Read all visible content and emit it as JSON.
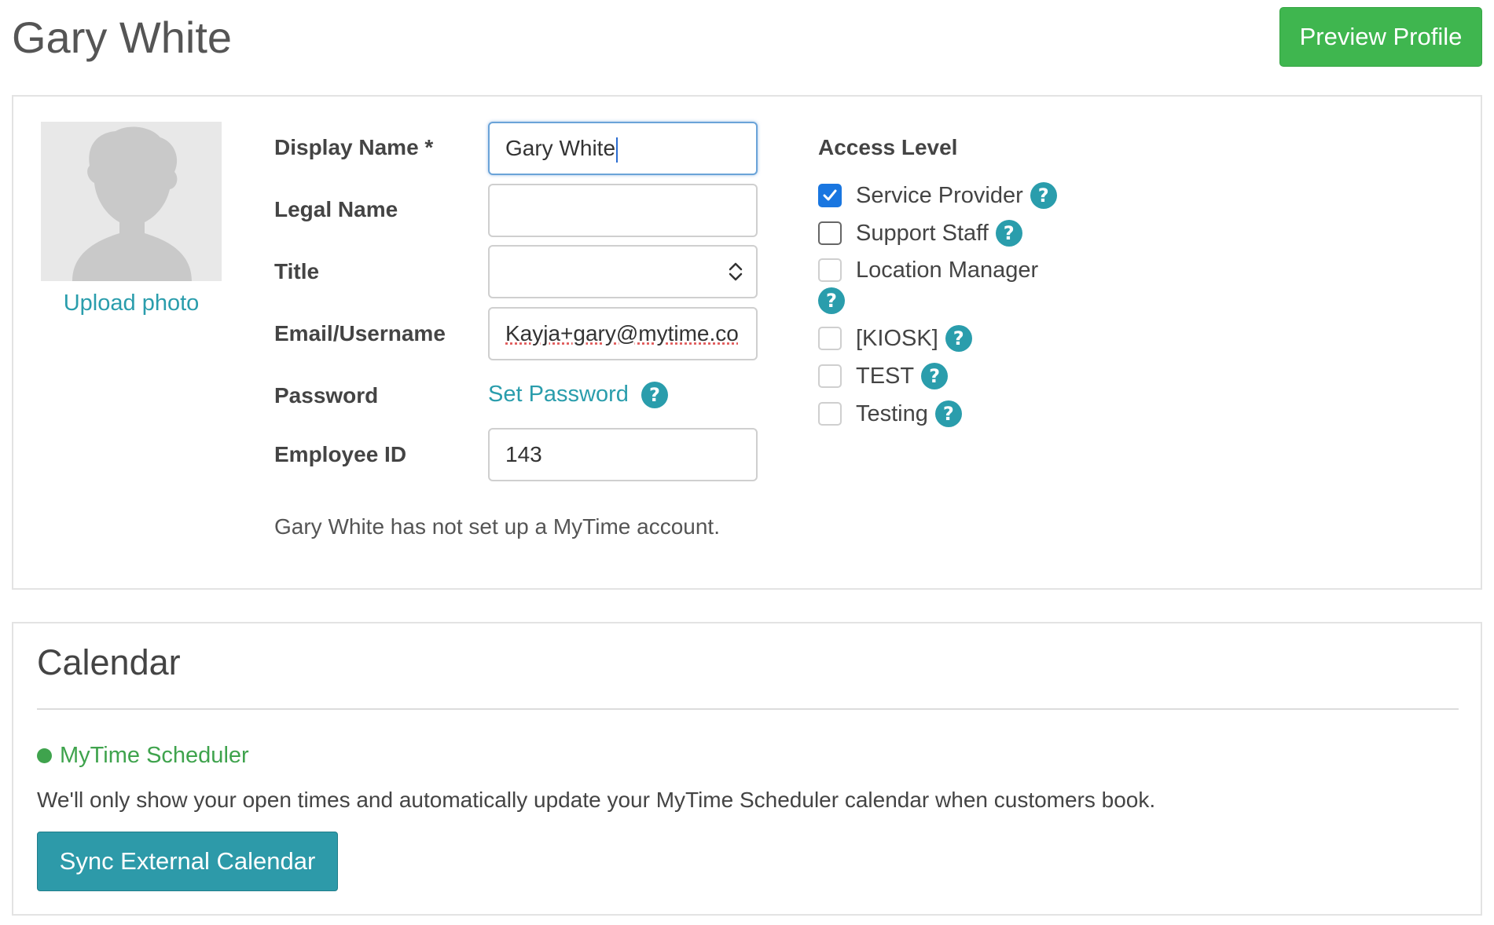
{
  "header": {
    "title": "Gary White",
    "preview_label": "Preview Profile"
  },
  "profile": {
    "upload_photo_label": "Upload photo",
    "fields": {
      "display_name_label": "Display Name *",
      "display_name_value": "Gary White",
      "legal_name_label": "Legal Name",
      "legal_name_value": "",
      "title_label": "Title",
      "title_value": "",
      "email_label": "Email/Username",
      "email_value": "Kayja+gary@mytime.co",
      "password_label": "Password",
      "set_password_label": "Set Password",
      "employee_id_label": "Employee ID",
      "employee_id_value": "143"
    },
    "account_notice": "Gary White has not set up a MyTime account."
  },
  "access_level": {
    "title": "Access Level",
    "help_glyph": "?",
    "options": [
      {
        "label": "Service Provider",
        "checked": true
      },
      {
        "label": "Support Staff",
        "checked": false
      },
      {
        "label": "Location Manager",
        "checked": false
      },
      {
        "label": "[KIOSK]",
        "checked": false
      },
      {
        "label": "TEST",
        "checked": false
      },
      {
        "label": "Testing",
        "checked": false
      }
    ]
  },
  "calendar": {
    "title": "Calendar",
    "provider_name": "MyTime Scheduler",
    "description": "We'll only show your open times and automatically update your MyTime Scheduler calendar when customers book.",
    "sync_label": "Sync External Calendar"
  },
  "colors": {
    "accent_green": "#3fb64f",
    "link_teal": "#2a9dac",
    "checkbox_blue": "#1976e0",
    "status_green": "#3fa34d"
  },
  "icons": {
    "help": "question-circle-icon",
    "check": "checkmark-icon",
    "select": "chevron-up-down-icon",
    "avatar": "avatar-placeholder-icon",
    "status": "status-dot-icon"
  }
}
